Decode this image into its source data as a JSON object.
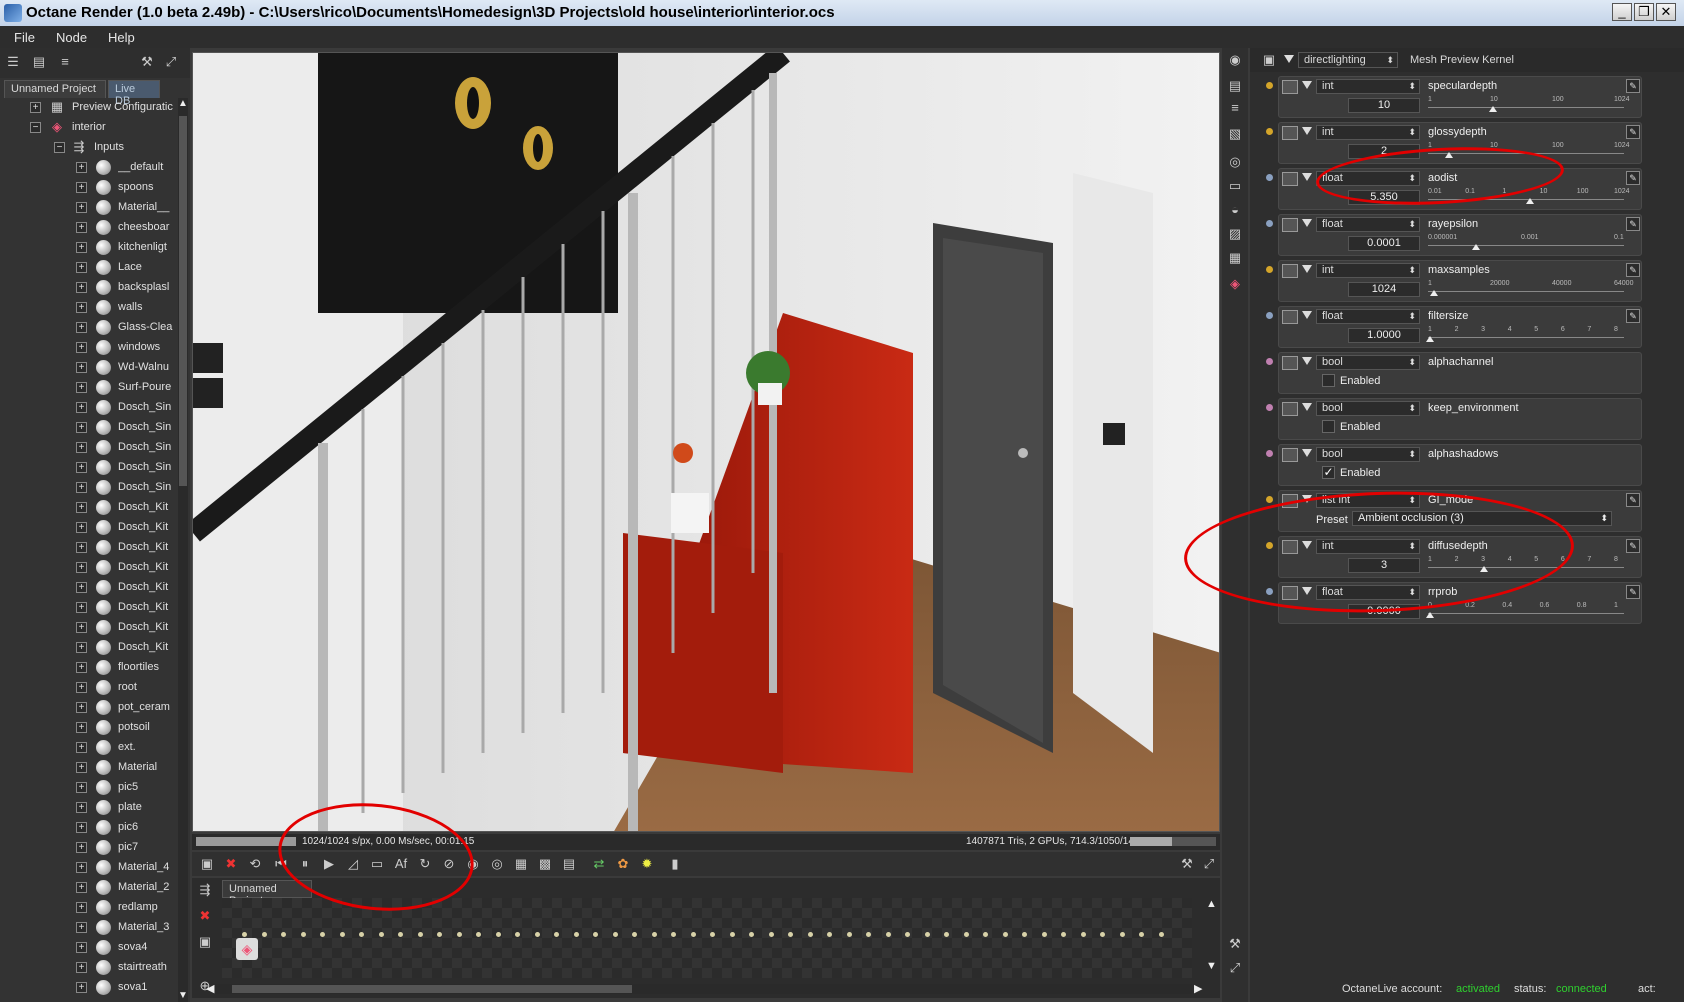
{
  "window": {
    "title": "Octane Render (1.0 beta 2.49b) - C:\\Users\\rico\\Documents\\Homedesign\\3D Projects\\old house\\interior\\interior.ocs",
    "minimize": "_",
    "maximize": "❐",
    "close": "✕"
  },
  "menu": {
    "file": "File",
    "node": "Node",
    "help": "Help"
  },
  "left_panel": {
    "tabs": [
      "Unnamed Project",
      "Live DB"
    ],
    "tree": {
      "preview": "Preview Configuratic",
      "interior": "interior",
      "inputs": "Inputs",
      "materials": [
        "__default",
        "spoons",
        "Material__",
        "cheesboar",
        "kitchenligt",
        "Lace",
        "backsplasl",
        "walls",
        "Glass-Clea",
        "windows",
        "Wd-Walnu",
        "Surf-Poure",
        "Dosch_Sin",
        "Dosch_Sin",
        "Dosch_Sin",
        "Dosch_Sin",
        "Dosch_Sin",
        "Dosch_Kit",
        "Dosch_Kit",
        "Dosch_Kit",
        "Dosch_Kit",
        "Dosch_Kit",
        "Dosch_Kit",
        "Dosch_Kit",
        "Dosch_Kit",
        "floortiles",
        "root",
        "pot_ceram",
        "potsoil",
        "ext.",
        "Material",
        "pic5",
        "plate",
        "pic6",
        "pic7",
        "Material_4",
        "Material_2",
        "redlamp",
        "Material_3",
        "sova4",
        "stairtreath",
        "sova1"
      ]
    }
  },
  "viewport": {
    "status_left": "1024/1024 s/px, 0.00 Ms/sec, 00:01:15",
    "status_right": "1407871 Tris, 2 GPUs, 714.3/1050/1471 MB",
    "progress": 1.0,
    "memory_fill": 0.49
  },
  "timeline": {
    "tab": "Unnamed Project"
  },
  "node_panel": {
    "kernel_select": "directlighting",
    "kernel_title": "Mesh Preview Kernel",
    "pins": [
      {
        "type": "int",
        "name": "speculardepth",
        "value": "10",
        "ticks": [
          "1",
          "10",
          "100",
          "1024"
        ],
        "knob": 0.33,
        "dot": "#d4a52a",
        "kind": "slider"
      },
      {
        "type": "int",
        "name": "glossydepth",
        "value": "2",
        "ticks": [
          "1",
          "10",
          "100",
          "1024"
        ],
        "knob": 0.1,
        "dot": "#d4a52a",
        "kind": "slider"
      },
      {
        "type": "float",
        "name": "aodist",
        "value": "5.350",
        "ticks": [
          "0.01",
          "0.1",
          "1",
          "10",
          "100",
          "1024"
        ],
        "knob": 0.52,
        "dot": "#8aa0c0",
        "kind": "slider"
      },
      {
        "type": "float",
        "name": "rayepsilon",
        "value": "0.0001",
        "ticks": [
          "0.000001",
          "0.001",
          "0.1"
        ],
        "knob": 0.24,
        "dot": "#8aa0c0",
        "kind": "slider"
      },
      {
        "type": "int",
        "name": "maxsamples",
        "value": "1024",
        "ticks": [
          "1",
          "20000",
          "40000",
          "64000"
        ],
        "knob": 0.02,
        "dot": "#d4a52a",
        "kind": "slider"
      },
      {
        "type": "float",
        "name": "filtersize",
        "value": "1.0000",
        "ticks": [
          "1",
          "2",
          "3",
          "4",
          "5",
          "6",
          "7",
          "8"
        ],
        "knob": 0.0,
        "dot": "#8aa0c0",
        "kind": "slider"
      },
      {
        "type": "bool",
        "name": "alphachannel",
        "checked": false,
        "label": "Enabled",
        "dot": "#c080b0",
        "kind": "bool"
      },
      {
        "type": "bool",
        "name": "keep_environment",
        "checked": false,
        "label": "Enabled",
        "dot": "#c080b0",
        "kind": "bool"
      },
      {
        "type": "bool",
        "name": "alphashadows",
        "checked": true,
        "label": "Enabled",
        "dot": "#c080b0",
        "kind": "bool"
      },
      {
        "type": "list int",
        "name": "GI_mode",
        "preset_label": "Preset",
        "preset": "Ambient occlusion (3)",
        "dot": "#d4a52a",
        "kind": "list"
      },
      {
        "type": "int",
        "name": "diffusedepth",
        "value": "3",
        "ticks": [
          "1",
          "2",
          "3",
          "4",
          "5",
          "6",
          "7",
          "8"
        ],
        "knob": 0.28,
        "dot": "#d4a52a",
        "kind": "slider"
      },
      {
        "type": "float",
        "name": "rrprob",
        "value": "0.0000",
        "ticks": [
          "0",
          "0.2",
          "0.4",
          "0.6",
          "0.8",
          "1"
        ],
        "knob": 0.0,
        "dot": "#8aa0c0",
        "kind": "slider"
      }
    ]
  },
  "footer": {
    "account_label": "OctaneLive account:",
    "account_value": "activated",
    "status_label": "status:",
    "status_value": "connected",
    "act_label": "act:"
  },
  "colors": {
    "accent_green": "#2fd02f",
    "annotation_red": "#e20000"
  }
}
